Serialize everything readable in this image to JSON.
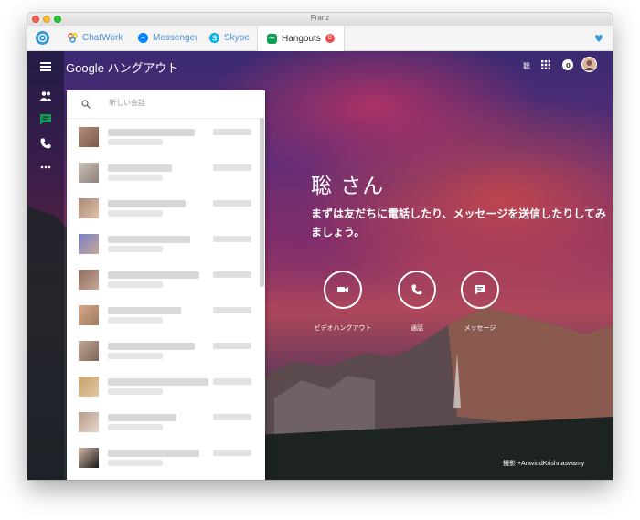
{
  "window": {
    "title": "Franz"
  },
  "tabs": [
    {
      "label": "ChatWork",
      "color": "#e74c3c",
      "icon": "chatwork-icon"
    },
    {
      "label": "Messenger",
      "color": "#0084ff",
      "icon": "messenger-icon"
    },
    {
      "label": "Skype",
      "color": "#00aff0",
      "icon": "skype-icon"
    },
    {
      "label": "Hangouts",
      "color": "#0f9d58",
      "icon": "hangouts-icon",
      "badge": "8",
      "active": true
    }
  ],
  "hangouts": {
    "brand": "Google ハングアウト",
    "top_right_text": "聡",
    "search_placeholder": "新しい会話",
    "greeting": "聡 さん",
    "subtitle": "まずは友だちに電話したり、メッセージを送信したりしてみましょう。",
    "actions": [
      {
        "label": "ビデオハングアウト",
        "icon": "video-icon"
      },
      {
        "label": "通話",
        "icon": "phone-icon"
      },
      {
        "label": "メッセージ",
        "icon": "message-icon"
      }
    ],
    "photo_credit": "撮影 +AravindKrishnaswamy"
  },
  "colors": {
    "accent": "#3498db",
    "hangouts_green": "#0f9d58",
    "badge_red": "#f04b4b"
  }
}
